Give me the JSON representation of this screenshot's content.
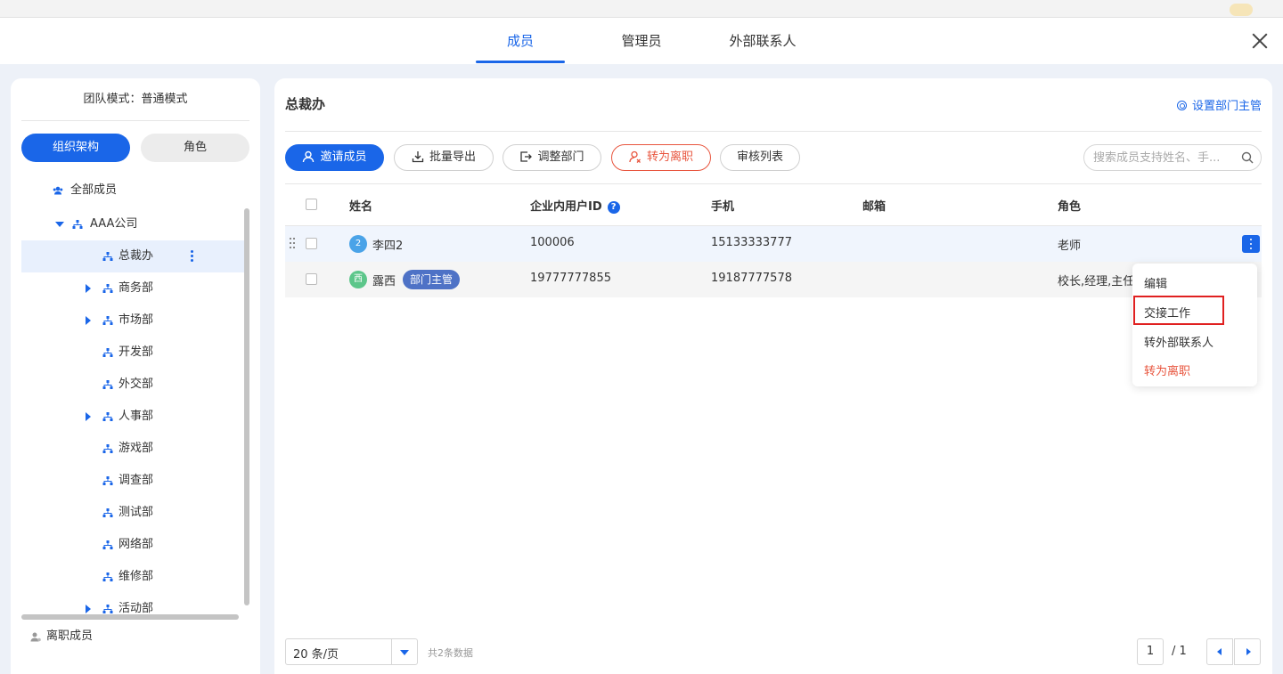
{
  "header": {
    "tabs": [
      {
        "label": "成员",
        "active": true
      },
      {
        "label": "管理员",
        "active": false
      },
      {
        "label": "外部联系人",
        "active": false
      }
    ]
  },
  "sidebar": {
    "mode_text": "团队模式：普通模式",
    "seg_org": "组织架构",
    "seg_role": "角色",
    "all_members": "全部成员",
    "company": "AAA公司",
    "departments": [
      {
        "label": "总裁办",
        "expandable": false,
        "selected": true
      },
      {
        "label": "商务部",
        "expandable": true
      },
      {
        "label": "市场部",
        "expandable": true
      },
      {
        "label": "开发部",
        "expandable": false
      },
      {
        "label": "外交部",
        "expandable": false
      },
      {
        "label": "人事部",
        "expandable": true
      },
      {
        "label": "游戏部",
        "expandable": false
      },
      {
        "label": "调查部",
        "expandable": false
      },
      {
        "label": "测试部",
        "expandable": false
      },
      {
        "label": "网络部",
        "expandable": false
      },
      {
        "label": "维修部",
        "expandable": false
      },
      {
        "label": "活动部",
        "expandable": true
      }
    ],
    "left_members": "离职成员"
  },
  "main": {
    "title": "总裁办",
    "set_head": "设置部门主管",
    "toolbar": {
      "invite": "邀请成员",
      "export": "批量导出",
      "adjust": "调整部门",
      "resign": "转为离职",
      "review": "审核列表"
    },
    "search_placeholder": "搜索成员支持姓名、手...",
    "columns": {
      "name": "姓名",
      "uid": "企业内用户ID",
      "phone": "手机",
      "email": "邮箱",
      "role": "角色"
    },
    "rows": [
      {
        "avatar": "2",
        "avatar_color": "#4aa3e8",
        "name": "李四2",
        "badge": "",
        "uid": "100006",
        "phone": "15133333777",
        "email": "",
        "role": "老师"
      },
      {
        "avatar": "西",
        "avatar_color": "#5cc68a",
        "name": "露西",
        "badge": "部门主管",
        "uid": "19777777855",
        "phone": "19187777578",
        "email": "",
        "role": "校长,经理,主任"
      }
    ],
    "menu": {
      "edit": "编辑",
      "handover": "交接工作",
      "to_external": "转外部联系人",
      "to_resign": "转为离职"
    },
    "pager": {
      "size": "20 条/页",
      "total": "共2条数据",
      "page": "1",
      "page_total": "/ 1"
    }
  },
  "colors": {
    "primary": "#1a66e8",
    "danger": "#e8553e",
    "badge": "#4e72c6",
    "highlight": "#e02020"
  }
}
